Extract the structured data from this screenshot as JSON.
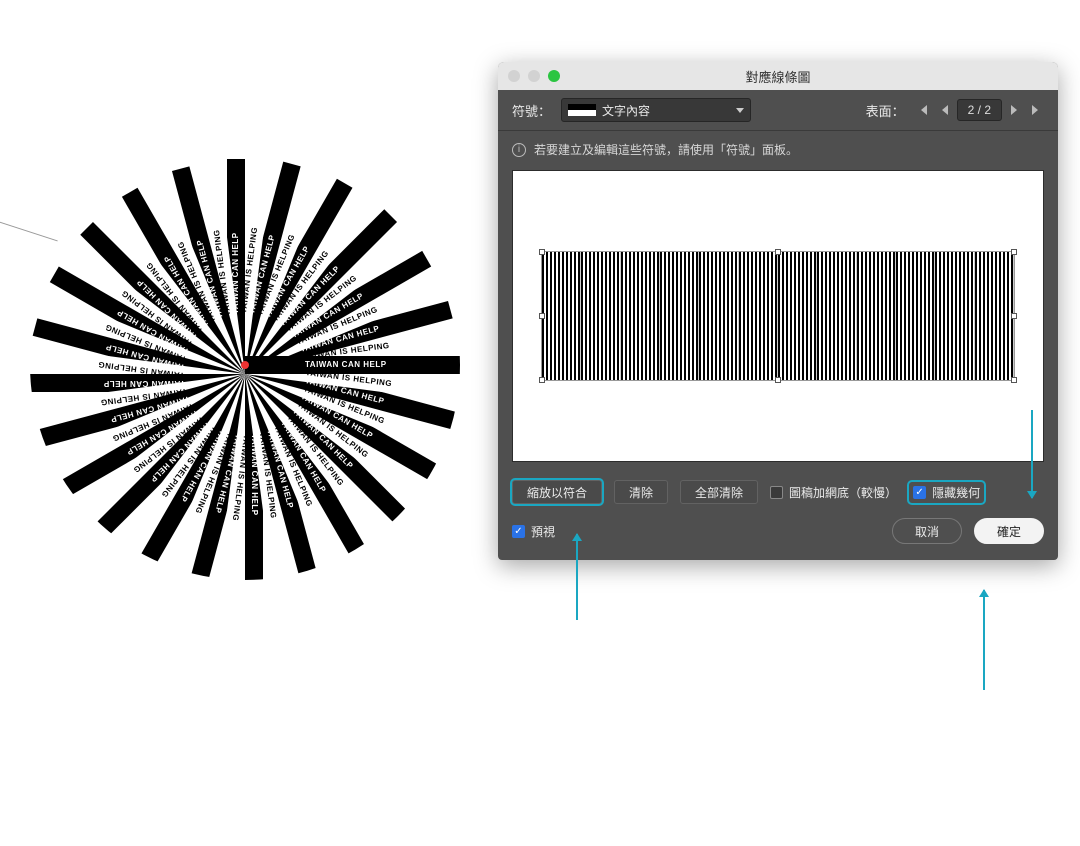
{
  "artwork": {
    "text_a": "TAIWAN CAN HELP",
    "text_b": "TAIWAN IS HELPING"
  },
  "dialog": {
    "title": "對應線條圖",
    "symbol_label": "符號：",
    "symbol_value": "文字內容",
    "surface_label": "表面：",
    "page_current": "2",
    "page_total": "2",
    "info_text": "若要建立及編輯這些符號，請使用「符號」面板。",
    "buttons": {
      "fit": "縮放以符合",
      "clear": "清除",
      "clear_all": "全部清除"
    },
    "checks": {
      "shade": "圖稿加網底（較慢）",
      "hide_geo": "隱藏幾何"
    },
    "preview_check": "預視",
    "cancel": "取消",
    "ok": "確定"
  }
}
